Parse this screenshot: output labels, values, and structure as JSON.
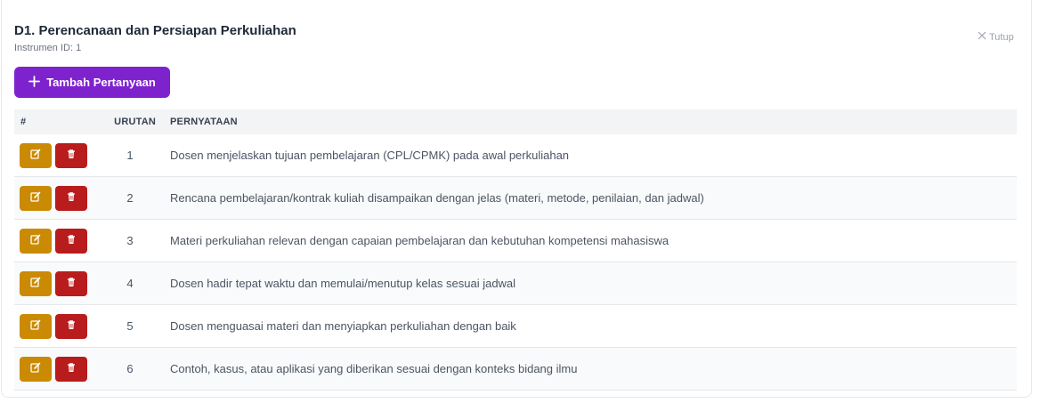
{
  "header": {
    "title": "D1. Perencanaan dan Persiapan Perkuliahan",
    "subtitle": "Instrumen ID: 1",
    "close_label": "Tutup"
  },
  "toolbar": {
    "add_label": "Tambah Pertanyaan"
  },
  "table": {
    "columns": [
      "#",
      "URUTAN",
      "PERNYATAAN"
    ],
    "rows": [
      {
        "urutan": "1",
        "pernyataan": "Dosen menjelaskan tujuan pembelajaran (CPL/CPMK) pada awal perkuliahan"
      },
      {
        "urutan": "2",
        "pernyataan": "Rencana pembelajaran/kontrak kuliah disampaikan dengan jelas (materi, metode, penilaian, dan jadwal)"
      },
      {
        "urutan": "3",
        "pernyataan": "Materi perkuliahan relevan dengan capaian pembelajaran dan kebutuhan kompetensi mahasiswa"
      },
      {
        "urutan": "4",
        "pernyataan": "Dosen hadir tepat waktu dan memulai/menutup kelas sesuai jadwal"
      },
      {
        "urutan": "5",
        "pernyataan": "Dosen menguasai materi dan menyiapkan perkuliahan dengan baik"
      },
      {
        "urutan": "6",
        "pernyataan": "Contoh, kasus, atau aplikasi yang diberikan sesuai dengan konteks bidang ilmu"
      }
    ]
  },
  "icons": {
    "edit": "edit-icon",
    "delete": "trash-icon",
    "close": "close-icon",
    "add": "plus-icon"
  },
  "colors": {
    "primary": "#7e22ce",
    "edit": "#ca8a04",
    "delete": "#b91c1c"
  }
}
